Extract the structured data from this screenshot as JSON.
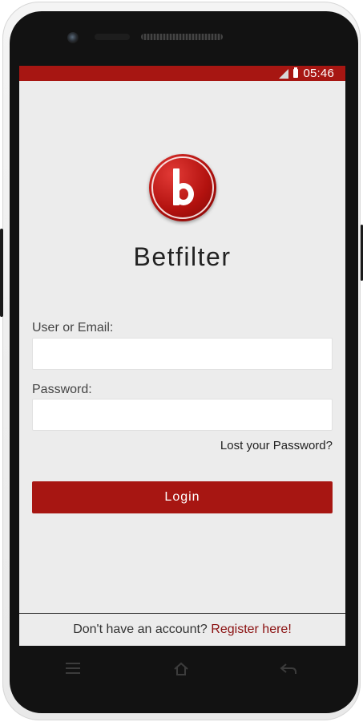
{
  "status_bar": {
    "time": "05:46",
    "signal_icon": "signal-icon",
    "battery_icon": "battery-icon",
    "color": "#a71612"
  },
  "app": {
    "name": "Betfilter",
    "logo_icon": "betfilter-logo-icon"
  },
  "form": {
    "user_label": "User or Email:",
    "user_value": "",
    "password_label": "Password:",
    "password_value": "",
    "lost_password": "Lost your Password?",
    "login_label": "Login"
  },
  "footer": {
    "prompt": "Don't have an account?",
    "register_label": "Register here!"
  },
  "nav_bar": {
    "icons": [
      "menu-icon",
      "home-icon",
      "back-icon"
    ]
  },
  "colors": {
    "accent": "#a71612",
    "link": "#8a1010",
    "screen_bg": "#ececec"
  }
}
